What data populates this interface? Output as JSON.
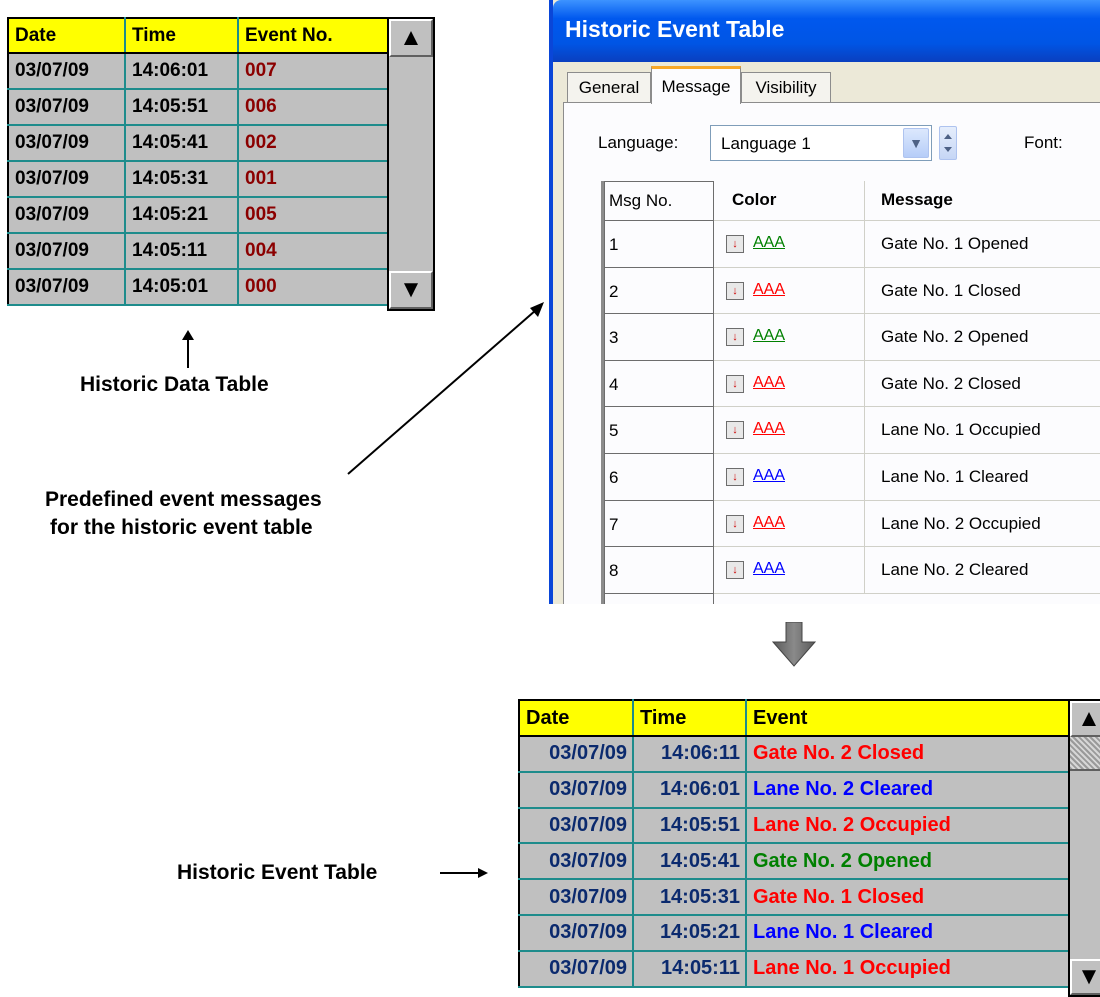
{
  "data_table": {
    "headers": [
      "Date",
      "Time",
      "Event No."
    ],
    "rows": [
      [
        "03/07/09",
        "14:06:01",
        "007"
      ],
      [
        "03/07/09",
        "14:05:51",
        "006"
      ],
      [
        "03/07/09",
        "14:05:41",
        "002"
      ],
      [
        "03/07/09",
        "14:05:31",
        "001"
      ],
      [
        "03/07/09",
        "14:05:21",
        "005"
      ],
      [
        "03/07/09",
        "14:05:11",
        "004"
      ],
      [
        "03/07/09",
        "14:05:01",
        "000"
      ]
    ],
    "caption": "Historic Data Table",
    "event_color": "#8b0000",
    "date_time_color": "#000000"
  },
  "annotation": {
    "line1": "Predefined event messages",
    "line2": "for the historic event table"
  },
  "dialog": {
    "title": "Historic Event Table",
    "tabs": [
      "General",
      "Message",
      "Visibility"
    ],
    "active_tab": "Message",
    "language_label": "Language:",
    "language_value": "Language 1",
    "font_label": "Font:",
    "grid_headers": [
      "Msg No.",
      "Color",
      "Message"
    ],
    "rows": [
      {
        "no": "1",
        "color_text": "AAA",
        "color": "#008000",
        "message": "Gate No. 1 Opened"
      },
      {
        "no": "2",
        "color_text": "AAA",
        "color": "#ff0000",
        "message": "Gate No. 1 Closed"
      },
      {
        "no": "3",
        "color_text": "AAA",
        "color": "#008000",
        "message": "Gate No. 2 Opened"
      },
      {
        "no": "4",
        "color_text": "AAA",
        "color": "#ff0000",
        "message": "Gate No. 2 Closed"
      },
      {
        "no": "5",
        "color_text": "AAA",
        "color": "#ff0000",
        "message": "Lane No. 1 Occupied"
      },
      {
        "no": "6",
        "color_text": "AAA",
        "color": "#0000ff",
        "message": "Lane No. 1 Cleared"
      },
      {
        "no": "7",
        "color_text": "AAA",
        "color": "#ff0000",
        "message": "Lane No. 2 Occupied"
      },
      {
        "no": "8",
        "color_text": "AAA",
        "color": "#0000ff",
        "message": "Lane No. 2 Cleared"
      }
    ]
  },
  "event_table": {
    "headers": [
      "Date",
      "Time",
      "Event"
    ],
    "rows": [
      {
        "date": "03/07/09",
        "time": "14:06:11",
        "event": "Gate No. 2 Closed",
        "color": "#ff0000"
      },
      {
        "date": "03/07/09",
        "time": "14:06:01",
        "event": "Lane No. 2 Cleared",
        "color": "#0000ff"
      },
      {
        "date": "03/07/09",
        "time": "14:05:51",
        "event": "Lane No. 2 Occupied",
        "color": "#ff0000"
      },
      {
        "date": "03/07/09",
        "time": "14:05:41",
        "event": "Gate No. 2 Opened",
        "color": "#008000"
      },
      {
        "date": "03/07/09",
        "time": "14:05:31",
        "event": "Gate No. 1 Closed",
        "color": "#ff0000"
      },
      {
        "date": "03/07/09",
        "time": "14:05:21",
        "event": "Lane No. 1 Cleared",
        "color": "#0000ff"
      },
      {
        "date": "03/07/09",
        "time": "14:05:11",
        "event": "Lane No. 1 Occupied",
        "color": "#ff0000"
      }
    ],
    "caption": "Historic Event Table",
    "date_time_color": "#0b2a6e"
  },
  "icons": {
    "scroll_up": "up-triangle-icon",
    "scroll_down": "down-triangle-icon",
    "pointer_arrow": "arrow-up-icon",
    "flow_arrow": "down-arrow-icon",
    "combo_drop": "chevron-down-icon",
    "spin": "spin-updown-icon",
    "color_picker": "color-dropdown-icon"
  }
}
